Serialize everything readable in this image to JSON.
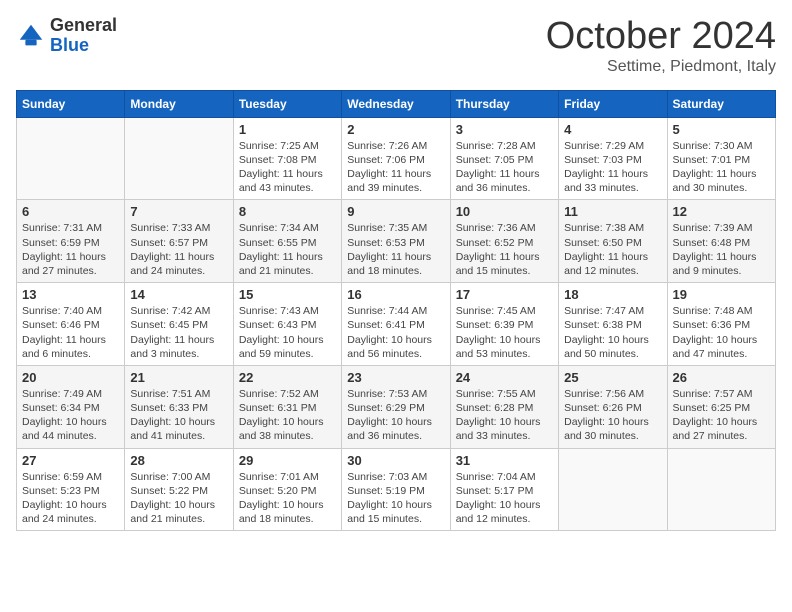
{
  "logo": {
    "general": "General",
    "blue": "Blue"
  },
  "header": {
    "month": "October 2024",
    "location": "Settime, Piedmont, Italy"
  },
  "weekdays": [
    "Sunday",
    "Monday",
    "Tuesday",
    "Wednesday",
    "Thursday",
    "Friday",
    "Saturday"
  ],
  "weeks": [
    [
      {
        "day": "",
        "info": ""
      },
      {
        "day": "",
        "info": ""
      },
      {
        "day": "1",
        "info": "Sunrise: 7:25 AM\nSunset: 7:08 PM\nDaylight: 11 hours and 43 minutes."
      },
      {
        "day": "2",
        "info": "Sunrise: 7:26 AM\nSunset: 7:06 PM\nDaylight: 11 hours and 39 minutes."
      },
      {
        "day": "3",
        "info": "Sunrise: 7:28 AM\nSunset: 7:05 PM\nDaylight: 11 hours and 36 minutes."
      },
      {
        "day": "4",
        "info": "Sunrise: 7:29 AM\nSunset: 7:03 PM\nDaylight: 11 hours and 33 minutes."
      },
      {
        "day": "5",
        "info": "Sunrise: 7:30 AM\nSunset: 7:01 PM\nDaylight: 11 hours and 30 minutes."
      }
    ],
    [
      {
        "day": "6",
        "info": "Sunrise: 7:31 AM\nSunset: 6:59 PM\nDaylight: 11 hours and 27 minutes."
      },
      {
        "day": "7",
        "info": "Sunrise: 7:33 AM\nSunset: 6:57 PM\nDaylight: 11 hours and 24 minutes."
      },
      {
        "day": "8",
        "info": "Sunrise: 7:34 AM\nSunset: 6:55 PM\nDaylight: 11 hours and 21 minutes."
      },
      {
        "day": "9",
        "info": "Sunrise: 7:35 AM\nSunset: 6:53 PM\nDaylight: 11 hours and 18 minutes."
      },
      {
        "day": "10",
        "info": "Sunrise: 7:36 AM\nSunset: 6:52 PM\nDaylight: 11 hours and 15 minutes."
      },
      {
        "day": "11",
        "info": "Sunrise: 7:38 AM\nSunset: 6:50 PM\nDaylight: 11 hours and 12 minutes."
      },
      {
        "day": "12",
        "info": "Sunrise: 7:39 AM\nSunset: 6:48 PM\nDaylight: 11 hours and 9 minutes."
      }
    ],
    [
      {
        "day": "13",
        "info": "Sunrise: 7:40 AM\nSunset: 6:46 PM\nDaylight: 11 hours and 6 minutes."
      },
      {
        "day": "14",
        "info": "Sunrise: 7:42 AM\nSunset: 6:45 PM\nDaylight: 11 hours and 3 minutes."
      },
      {
        "day": "15",
        "info": "Sunrise: 7:43 AM\nSunset: 6:43 PM\nDaylight: 10 hours and 59 minutes."
      },
      {
        "day": "16",
        "info": "Sunrise: 7:44 AM\nSunset: 6:41 PM\nDaylight: 10 hours and 56 minutes."
      },
      {
        "day": "17",
        "info": "Sunrise: 7:45 AM\nSunset: 6:39 PM\nDaylight: 10 hours and 53 minutes."
      },
      {
        "day": "18",
        "info": "Sunrise: 7:47 AM\nSunset: 6:38 PM\nDaylight: 10 hours and 50 minutes."
      },
      {
        "day": "19",
        "info": "Sunrise: 7:48 AM\nSunset: 6:36 PM\nDaylight: 10 hours and 47 minutes."
      }
    ],
    [
      {
        "day": "20",
        "info": "Sunrise: 7:49 AM\nSunset: 6:34 PM\nDaylight: 10 hours and 44 minutes."
      },
      {
        "day": "21",
        "info": "Sunrise: 7:51 AM\nSunset: 6:33 PM\nDaylight: 10 hours and 41 minutes."
      },
      {
        "day": "22",
        "info": "Sunrise: 7:52 AM\nSunset: 6:31 PM\nDaylight: 10 hours and 38 minutes."
      },
      {
        "day": "23",
        "info": "Sunrise: 7:53 AM\nSunset: 6:29 PM\nDaylight: 10 hours and 36 minutes."
      },
      {
        "day": "24",
        "info": "Sunrise: 7:55 AM\nSunset: 6:28 PM\nDaylight: 10 hours and 33 minutes."
      },
      {
        "day": "25",
        "info": "Sunrise: 7:56 AM\nSunset: 6:26 PM\nDaylight: 10 hours and 30 minutes."
      },
      {
        "day": "26",
        "info": "Sunrise: 7:57 AM\nSunset: 6:25 PM\nDaylight: 10 hours and 27 minutes."
      }
    ],
    [
      {
        "day": "27",
        "info": "Sunrise: 6:59 AM\nSunset: 5:23 PM\nDaylight: 10 hours and 24 minutes."
      },
      {
        "day": "28",
        "info": "Sunrise: 7:00 AM\nSunset: 5:22 PM\nDaylight: 10 hours and 21 minutes."
      },
      {
        "day": "29",
        "info": "Sunrise: 7:01 AM\nSunset: 5:20 PM\nDaylight: 10 hours and 18 minutes."
      },
      {
        "day": "30",
        "info": "Sunrise: 7:03 AM\nSunset: 5:19 PM\nDaylight: 10 hours and 15 minutes."
      },
      {
        "day": "31",
        "info": "Sunrise: 7:04 AM\nSunset: 5:17 PM\nDaylight: 10 hours and 12 minutes."
      },
      {
        "day": "",
        "info": ""
      },
      {
        "day": "",
        "info": ""
      }
    ]
  ]
}
